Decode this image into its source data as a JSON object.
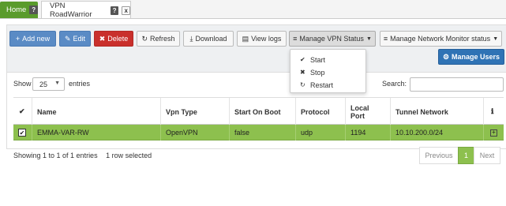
{
  "tabs": {
    "home_label": "Home",
    "home_icon": "?",
    "vpn_label": "VPN RoadWarrior",
    "vpn_help_icon": "?",
    "vpn_close_icon": "x"
  },
  "toolbar": {
    "add_new": "Add new",
    "edit": "Edit",
    "delete": "Delete",
    "refresh": "Refresh",
    "download": "Download",
    "view_logs": "View logs",
    "manage_vpn_status": "Manage VPN Status",
    "manage_network_monitor": "Manage Network Monitor status",
    "manage_users": "Manage Users"
  },
  "vpn_status_menu": {
    "items": [
      "Start",
      "Stop",
      "Restart"
    ]
  },
  "table_controls": {
    "show_label": "Show",
    "entries_value": "25",
    "entries_label": "entries",
    "search_label": "Search:",
    "search_value": ""
  },
  "table": {
    "headers": [
      "Name",
      "Vpn Type",
      "Start On Boot",
      "Protocol",
      "Local Port",
      "Tunnel Network"
    ],
    "header_local_port_line1": "Local",
    "header_local_port_line2": "Port",
    "rows": [
      {
        "name": "EMMA-VAR-RW",
        "vpn_type": "OpenVPN",
        "start_on_boot": "false",
        "protocol": "udp",
        "local_port": "1194",
        "tunnel_network": "10.10.200.0/24"
      }
    ]
  },
  "footer": {
    "info": "Showing 1 to 1 of 1 entries",
    "selected": "1 row selected",
    "previous": "Previous",
    "current_page": "1",
    "next": "Next"
  },
  "colors": {
    "home_tab": "#5a9b2c",
    "selected_row": "#8dc04e",
    "delete_button": "#c9302c",
    "primary_button": "#2f73b5"
  }
}
